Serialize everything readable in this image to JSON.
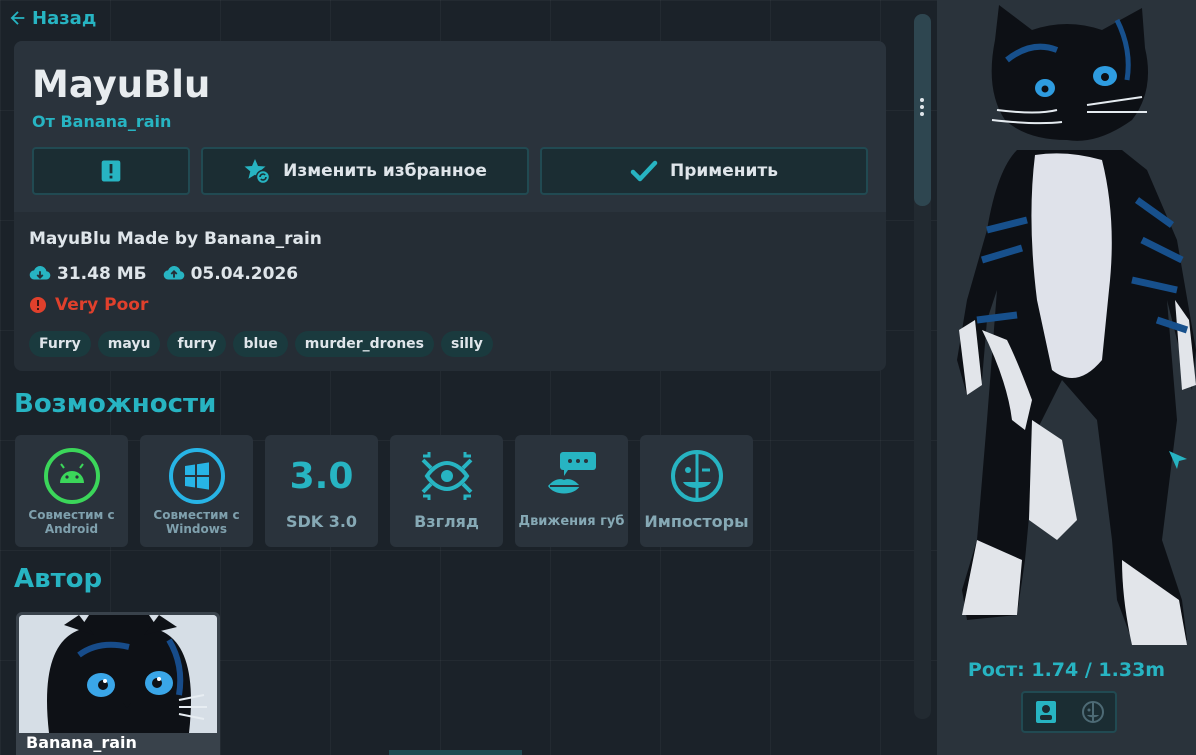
{
  "nav": {
    "back_label": "Назад"
  },
  "avatar": {
    "name": "MayuBlu",
    "author_line": "От Banana_rain",
    "description": "MayuBlu Made by Banana_rain",
    "size": "31.48 МБ",
    "date": "05.04.2026",
    "performance": "Very Poor",
    "tags": [
      "Furry",
      "mayu",
      "furry",
      "blue",
      "murder_drones",
      "silly"
    ]
  },
  "actions": {
    "report_icon": "exclamation-icon",
    "favorite_label": "Изменить избранное",
    "apply_label": "Применить"
  },
  "features": {
    "title": "Возможности",
    "items": [
      {
        "label": "Совместим с Android",
        "icon": "android-icon"
      },
      {
        "label": "Совместим с Windows",
        "icon": "windows-icon"
      },
      {
        "label": "SDK 3.0",
        "icon_text": "3.0",
        "icon": "sdk-icon"
      },
      {
        "label": "Взгляд",
        "icon": "eye-tracking-icon"
      },
      {
        "label": "Движения губ",
        "icon": "lip-sync-icon"
      },
      {
        "label": "Импосторы",
        "icon": "impostor-icon"
      }
    ]
  },
  "author_section": {
    "title": "Автор",
    "author_name": "Banana_rain"
  },
  "preview": {
    "height_text": "Рост: 1.74 / 1.33m"
  },
  "colors": {
    "accent": "#27b4c2",
    "warning": "#e0402c",
    "background": "#1b2229",
    "card": "#252d35"
  }
}
